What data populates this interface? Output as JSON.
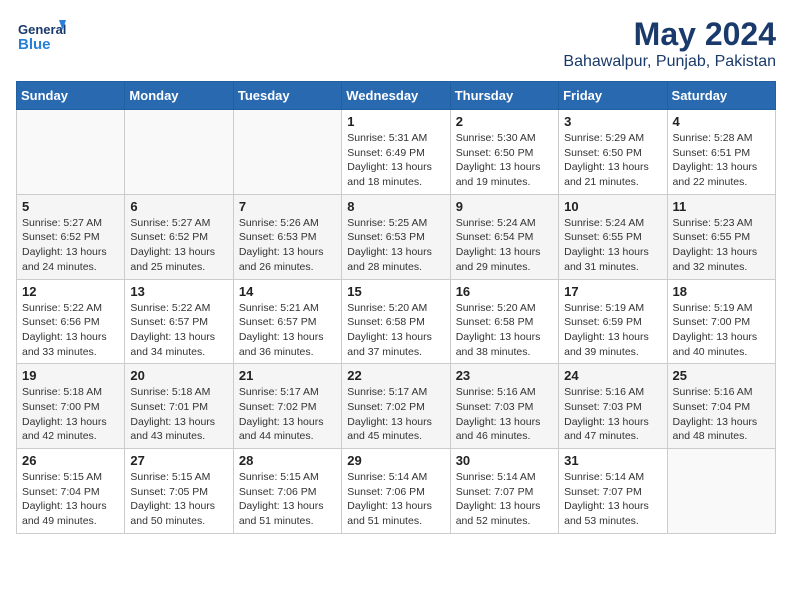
{
  "logo": {
    "line1": "General",
    "line2": "Blue"
  },
  "title": "May 2024",
  "subtitle": "Bahawalpur, Punjab, Pakistan",
  "weekdays": [
    "Sunday",
    "Monday",
    "Tuesday",
    "Wednesday",
    "Thursday",
    "Friday",
    "Saturday"
  ],
  "weeks": [
    [
      {
        "day": "",
        "info": ""
      },
      {
        "day": "",
        "info": ""
      },
      {
        "day": "",
        "info": ""
      },
      {
        "day": "1",
        "info": "Sunrise: 5:31 AM\nSunset: 6:49 PM\nDaylight: 13 hours\nand 18 minutes."
      },
      {
        "day": "2",
        "info": "Sunrise: 5:30 AM\nSunset: 6:50 PM\nDaylight: 13 hours\nand 19 minutes."
      },
      {
        "day": "3",
        "info": "Sunrise: 5:29 AM\nSunset: 6:50 PM\nDaylight: 13 hours\nand 21 minutes."
      },
      {
        "day": "4",
        "info": "Sunrise: 5:28 AM\nSunset: 6:51 PM\nDaylight: 13 hours\nand 22 minutes."
      }
    ],
    [
      {
        "day": "5",
        "info": "Sunrise: 5:27 AM\nSunset: 6:52 PM\nDaylight: 13 hours\nand 24 minutes."
      },
      {
        "day": "6",
        "info": "Sunrise: 5:27 AM\nSunset: 6:52 PM\nDaylight: 13 hours\nand 25 minutes."
      },
      {
        "day": "7",
        "info": "Sunrise: 5:26 AM\nSunset: 6:53 PM\nDaylight: 13 hours\nand 26 minutes."
      },
      {
        "day": "8",
        "info": "Sunrise: 5:25 AM\nSunset: 6:53 PM\nDaylight: 13 hours\nand 28 minutes."
      },
      {
        "day": "9",
        "info": "Sunrise: 5:24 AM\nSunset: 6:54 PM\nDaylight: 13 hours\nand 29 minutes."
      },
      {
        "day": "10",
        "info": "Sunrise: 5:24 AM\nSunset: 6:55 PM\nDaylight: 13 hours\nand 31 minutes."
      },
      {
        "day": "11",
        "info": "Sunrise: 5:23 AM\nSunset: 6:55 PM\nDaylight: 13 hours\nand 32 minutes."
      }
    ],
    [
      {
        "day": "12",
        "info": "Sunrise: 5:22 AM\nSunset: 6:56 PM\nDaylight: 13 hours\nand 33 minutes."
      },
      {
        "day": "13",
        "info": "Sunrise: 5:22 AM\nSunset: 6:57 PM\nDaylight: 13 hours\nand 34 minutes."
      },
      {
        "day": "14",
        "info": "Sunrise: 5:21 AM\nSunset: 6:57 PM\nDaylight: 13 hours\nand 36 minutes."
      },
      {
        "day": "15",
        "info": "Sunrise: 5:20 AM\nSunset: 6:58 PM\nDaylight: 13 hours\nand 37 minutes."
      },
      {
        "day": "16",
        "info": "Sunrise: 5:20 AM\nSunset: 6:58 PM\nDaylight: 13 hours\nand 38 minutes."
      },
      {
        "day": "17",
        "info": "Sunrise: 5:19 AM\nSunset: 6:59 PM\nDaylight: 13 hours\nand 39 minutes."
      },
      {
        "day": "18",
        "info": "Sunrise: 5:19 AM\nSunset: 7:00 PM\nDaylight: 13 hours\nand 40 minutes."
      }
    ],
    [
      {
        "day": "19",
        "info": "Sunrise: 5:18 AM\nSunset: 7:00 PM\nDaylight: 13 hours\nand 42 minutes."
      },
      {
        "day": "20",
        "info": "Sunrise: 5:18 AM\nSunset: 7:01 PM\nDaylight: 13 hours\nand 43 minutes."
      },
      {
        "day": "21",
        "info": "Sunrise: 5:17 AM\nSunset: 7:02 PM\nDaylight: 13 hours\nand 44 minutes."
      },
      {
        "day": "22",
        "info": "Sunrise: 5:17 AM\nSunset: 7:02 PM\nDaylight: 13 hours\nand 45 minutes."
      },
      {
        "day": "23",
        "info": "Sunrise: 5:16 AM\nSunset: 7:03 PM\nDaylight: 13 hours\nand 46 minutes."
      },
      {
        "day": "24",
        "info": "Sunrise: 5:16 AM\nSunset: 7:03 PM\nDaylight: 13 hours\nand 47 minutes."
      },
      {
        "day": "25",
        "info": "Sunrise: 5:16 AM\nSunset: 7:04 PM\nDaylight: 13 hours\nand 48 minutes."
      }
    ],
    [
      {
        "day": "26",
        "info": "Sunrise: 5:15 AM\nSunset: 7:04 PM\nDaylight: 13 hours\nand 49 minutes."
      },
      {
        "day": "27",
        "info": "Sunrise: 5:15 AM\nSunset: 7:05 PM\nDaylight: 13 hours\nand 50 minutes."
      },
      {
        "day": "28",
        "info": "Sunrise: 5:15 AM\nSunset: 7:06 PM\nDaylight: 13 hours\nand 51 minutes."
      },
      {
        "day": "29",
        "info": "Sunrise: 5:14 AM\nSunset: 7:06 PM\nDaylight: 13 hours\nand 51 minutes."
      },
      {
        "day": "30",
        "info": "Sunrise: 5:14 AM\nSunset: 7:07 PM\nDaylight: 13 hours\nand 52 minutes."
      },
      {
        "day": "31",
        "info": "Sunrise: 5:14 AM\nSunset: 7:07 PM\nDaylight: 13 hours\nand 53 minutes."
      },
      {
        "day": "",
        "info": ""
      }
    ]
  ]
}
